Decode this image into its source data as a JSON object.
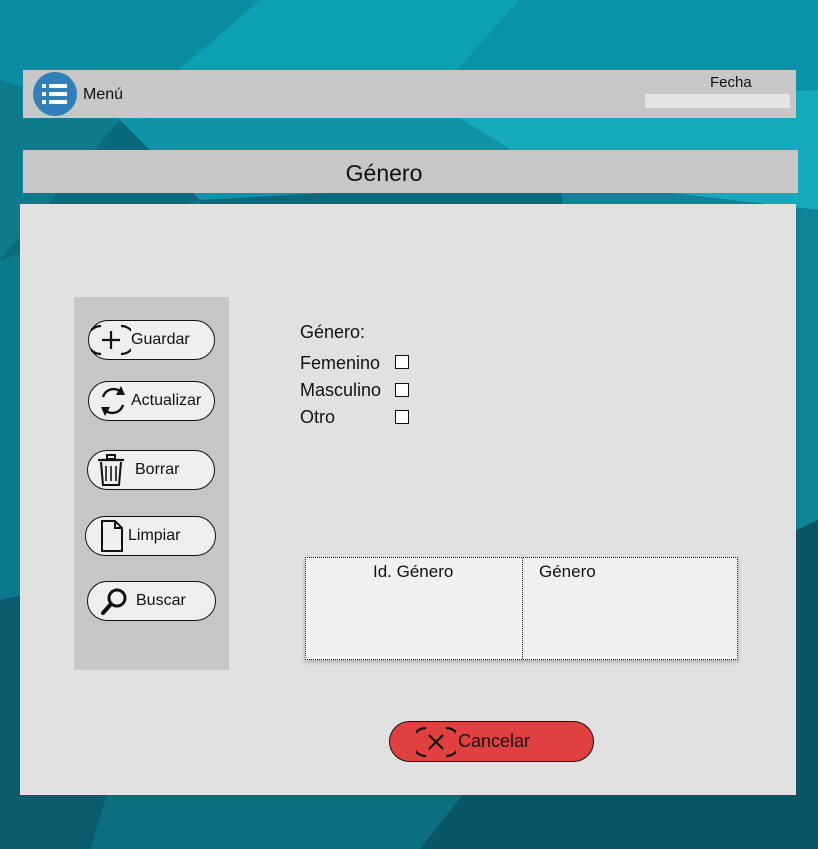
{
  "header": {
    "menu_label": "Menú",
    "date_label": "Fecha",
    "date_value": ""
  },
  "page": {
    "title": "Género"
  },
  "actions": {
    "guardar": "Guardar",
    "actualizar": "Actualizar",
    "borrar": "Borrar",
    "limpiar": "Limpiar",
    "buscar": "Buscar"
  },
  "form": {
    "group_label": "Género:",
    "options": [
      {
        "label": "Femenino",
        "checked": false
      },
      {
        "label": "Masculino",
        "checked": false
      },
      {
        "label": "Otro",
        "checked": false
      }
    ]
  },
  "table": {
    "columns": [
      "Id. Género",
      "Género"
    ],
    "rows": []
  },
  "footer": {
    "cancel_label": "Cancelar"
  },
  "colors": {
    "background": "#0b6f82",
    "bar": "#c7c7c7",
    "panel": "#e1e1e1",
    "cancel": "#e04040",
    "menu_icon": "#2f7fb8"
  },
  "icons": {
    "menu": "list-icon",
    "guardar": "plus-circle-icon",
    "actualizar": "refresh-icon",
    "borrar": "trash-icon",
    "limpiar": "document-icon",
    "buscar": "search-icon",
    "cancelar": "close-circle-icon"
  }
}
